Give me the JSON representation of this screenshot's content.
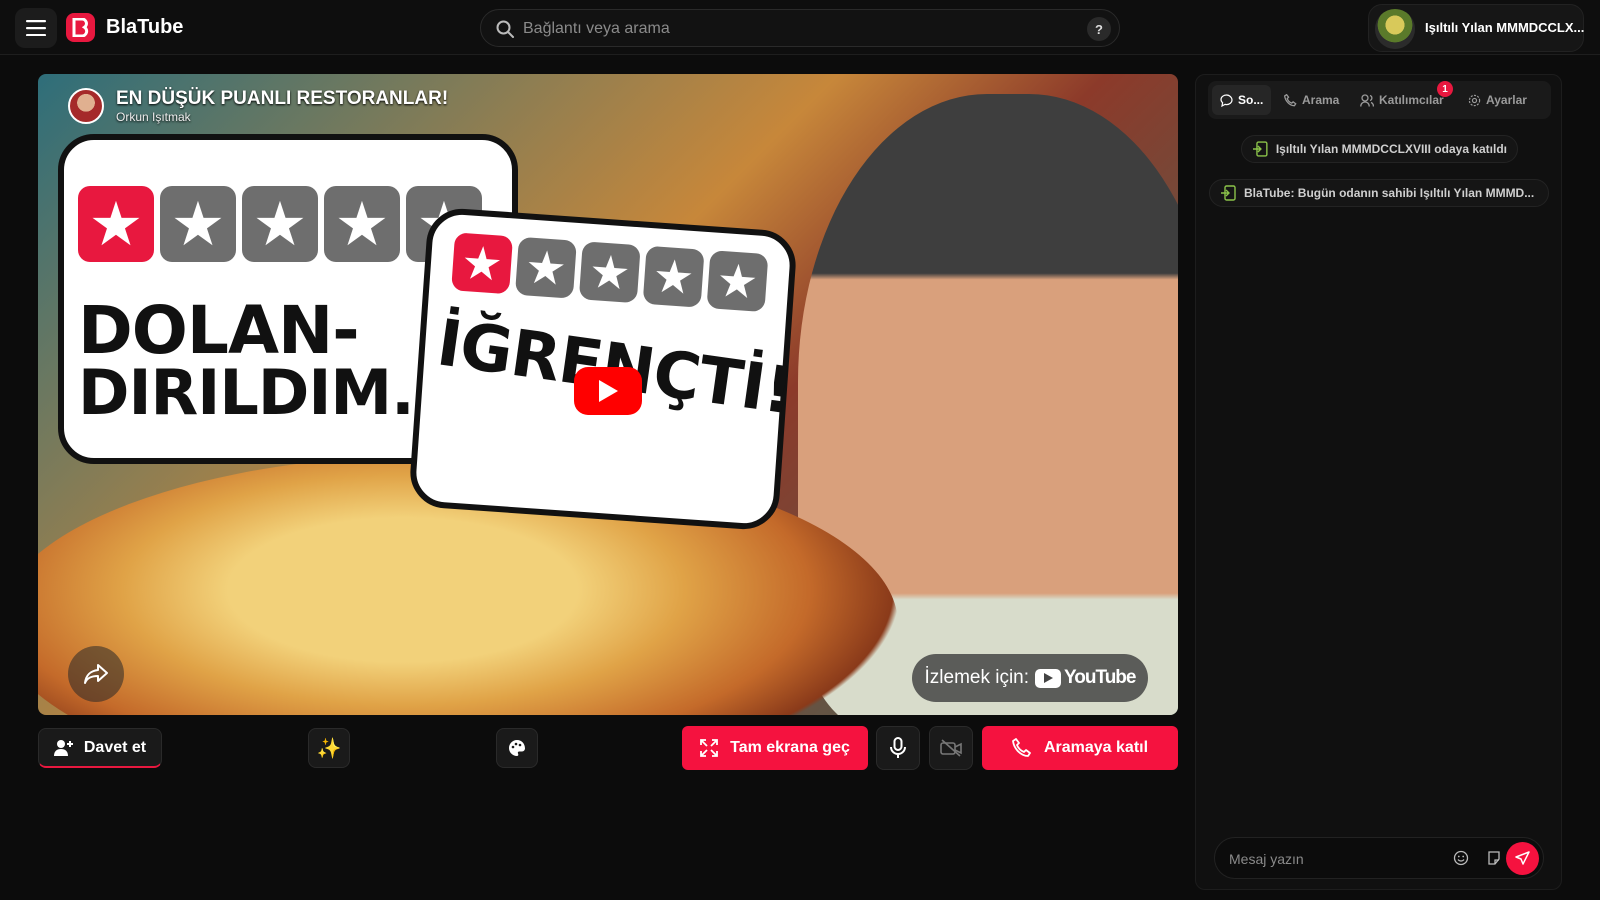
{
  "header": {
    "brand": "BlaTube",
    "search_placeholder": "Bağlantı veya arama",
    "help_label": "?",
    "user_name": "Işıltılı Yılan MMMDCCLX..."
  },
  "video": {
    "title": "EN DÜŞÜK PUANLI RESTORANLAR!",
    "channel": "Orkun Işıtmak",
    "bubble1_line1": "DOLAN-",
    "bubble1_line2": "DIRILDIM.",
    "bubble2_text": "İĞRENÇTİ!",
    "watch_label": "İzlemek için:",
    "youtube_label": "YouTube",
    "bubble1_rating": 1,
    "bubble2_rating": 1,
    "max_rating": 5
  },
  "controls": {
    "invite_label": "Davet et",
    "fullscreen_label": "Tam ekrana geç",
    "join_call_label": "Aramaya katıl"
  },
  "sidebar": {
    "tabs": [
      {
        "label": "So..."
      },
      {
        "label": "Arama"
      },
      {
        "label": "Katılımcılar"
      },
      {
        "label": "Ayarlar"
      }
    ],
    "participants_badge": "1",
    "messages": [
      {
        "text": "Işıltılı Yılan MMMDCCLXVIII odaya katıldı"
      },
      {
        "text": "BlaTube: Bugün odanın sahibi Işıltılı Yılan MMMD..."
      }
    ],
    "composer_placeholder": "Mesaj yazın"
  },
  "colors": {
    "accent": "#f5123f",
    "background": "#0c0c0c",
    "panel": "#101010"
  }
}
